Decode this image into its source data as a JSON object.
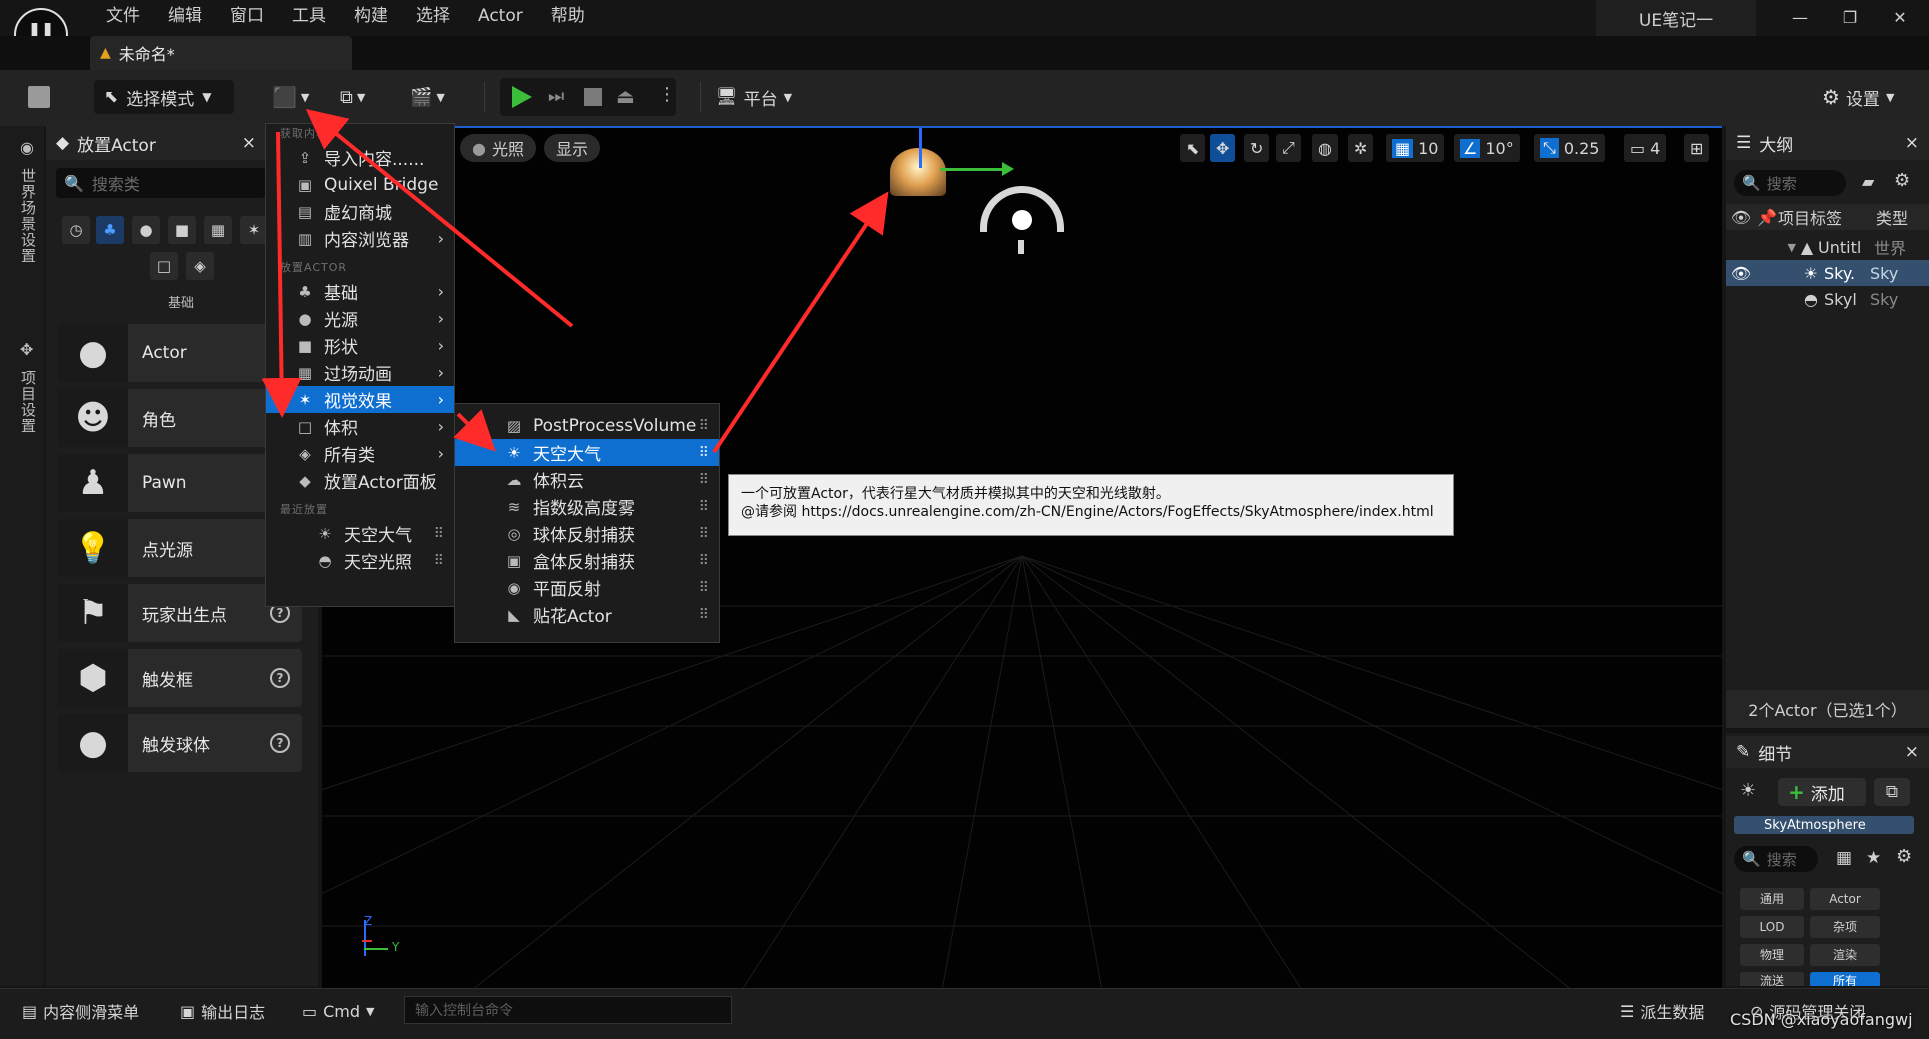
{
  "app": {
    "logo_text": "U",
    "menu": [
      "文件",
      "编辑",
      "窗口",
      "工具",
      "构建",
      "选择",
      "Actor",
      "帮助"
    ],
    "project_title": "UE笔记一",
    "window_controls": [
      "—",
      "❐",
      "✕"
    ],
    "document_tab": "未命名*"
  },
  "toolbar": {
    "select_mode": "选择模式",
    "platform": "平台",
    "settings": "设置"
  },
  "left_strip": {
    "world_settings": "世界场景设置",
    "project_settings": "项目设置"
  },
  "place_actor": {
    "title": "放置Actor",
    "close": "×",
    "search_placeholder": "搜索类",
    "category_label": "基础",
    "items": [
      {
        "label": "Actor",
        "icon": "sphere-icon",
        "glyph": "●"
      },
      {
        "label": "角色",
        "icon": "character-icon",
        "glyph": "☻"
      },
      {
        "label": "Pawn",
        "icon": "pawn-icon",
        "glyph": "♟"
      },
      {
        "label": "点光源",
        "icon": "bulb-icon",
        "glyph": "💡"
      },
      {
        "label": "玩家出生点",
        "icon": "flag-icon",
        "glyph": "⚑"
      },
      {
        "label": "触发框",
        "icon": "cube-icon",
        "glyph": "⬢"
      },
      {
        "label": "触发球体",
        "icon": "sphere-icon",
        "glyph": "●"
      }
    ],
    "help": "?"
  },
  "viewport": {
    "lit": "光照",
    "show": "显示",
    "grid_snap": "10",
    "rotation_snap": "10°",
    "scale_snap": "0.25",
    "camera_speed": "4",
    "axis_z": "Z",
    "axis_y": "Y"
  },
  "add_menu": {
    "section_get": "获取内容",
    "get_items": [
      {
        "label": "导入内容......",
        "glyph": "⇪"
      },
      {
        "label": "Quixel Bridge",
        "glyph": "▣"
      },
      {
        "label": "虚幻商城",
        "glyph": "▤"
      },
      {
        "label": "内容浏览器",
        "glyph": "▥"
      }
    ],
    "section_place": "放置ACTOR",
    "place_items": [
      {
        "label": "基础",
        "glyph": "♣"
      },
      {
        "label": "光源",
        "glyph": "●"
      },
      {
        "label": "形状",
        "glyph": "■"
      },
      {
        "label": "过场动画",
        "glyph": "▦"
      },
      {
        "label": "视觉效果",
        "glyph": "✶"
      },
      {
        "label": "体积",
        "glyph": "□"
      },
      {
        "label": "所有类",
        "glyph": "◈"
      },
      {
        "label": "放置Actor面板",
        "glyph": "◆"
      }
    ],
    "section_recent": "最近放置",
    "recent_items": [
      {
        "label": "天空大气",
        "glyph": "☀"
      },
      {
        "label": "天空光照",
        "glyph": "◓"
      }
    ]
  },
  "visual_effects_menu": {
    "items": [
      {
        "label": "PostProcessVolume",
        "glyph": "▨"
      },
      {
        "label": "天空大气",
        "glyph": "☀"
      },
      {
        "label": "体积云",
        "glyph": "☁"
      },
      {
        "label": "指数级高度雾",
        "glyph": "≋"
      },
      {
        "label": "球体反射捕获",
        "glyph": "◎"
      },
      {
        "label": "盒体反射捕获",
        "glyph": "▣"
      },
      {
        "label": "平面反射",
        "glyph": "◉"
      },
      {
        "label": "贴花Actor",
        "glyph": "◣"
      }
    ]
  },
  "tooltip": {
    "line1": "一个可放置Actor，代表行星大气材质并模拟其中的天空和光线散射。",
    "line2": "@请参阅 https://docs.unrealengine.com/zh-CN/Engine/Actors/FogEffects/SkyAtmosphere/index.html"
  },
  "outliner": {
    "title": "大纲",
    "close": "×",
    "search_placeholder": "搜索",
    "col_label": "项目标签",
    "col_type": "类型",
    "rows": [
      {
        "label": "Untitl",
        "type": "世界"
      },
      {
        "label": "Sky.",
        "type": "Sky"
      },
      {
        "label": "Skyl",
        "type": "Sky"
      }
    ],
    "footer": "2个Actor（已选1个）"
  },
  "details": {
    "title": "细节",
    "close": "×",
    "add": "添加",
    "component": "SkyAtmosphere",
    "search_placeholder": "搜索",
    "filters": [
      "通用",
      "Actor",
      "LOD",
      "杂项",
      "物理",
      "渲染",
      "流送",
      "所有"
    ]
  },
  "statusbar": {
    "content_drawer": "内容侧滑菜单",
    "output_log": "输出日志",
    "cmd": "Cmd",
    "console_placeholder": "输入控制台命令",
    "derived_data": "派生数据",
    "source_control": "源码管理关闭",
    "watermark": "CSDN @xiaoyaofangwj"
  },
  "colors": {
    "accent": "#0f6fd0",
    "play_green": "#3bbf3b",
    "annotation_red": "#ff2a2a"
  }
}
